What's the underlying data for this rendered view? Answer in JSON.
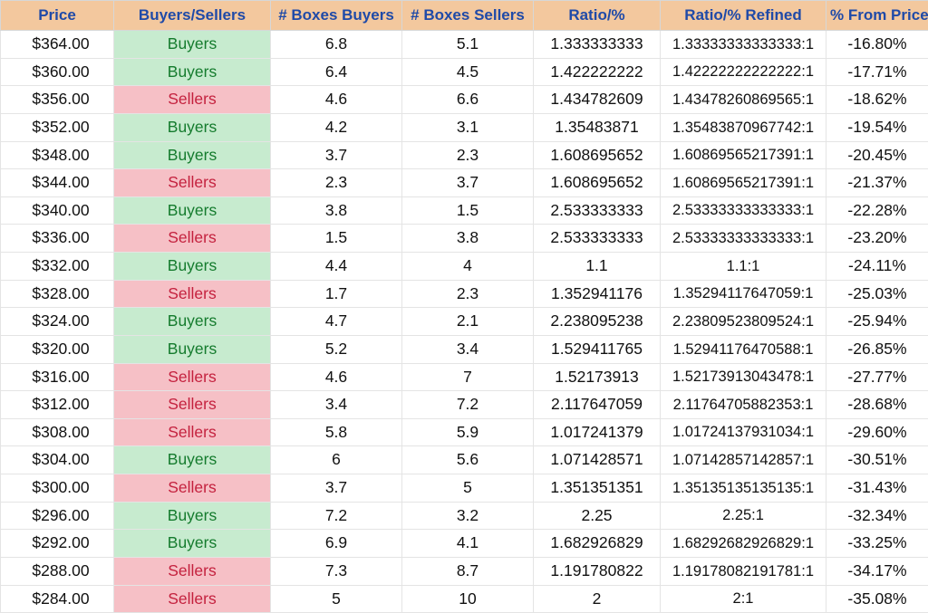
{
  "headers": {
    "price": "Price",
    "bs": "Buyers/Sellers",
    "boxes_buyers": "# Boxes Buyers",
    "boxes_sellers": "# Boxes Sellers",
    "ratio": "Ratio/%",
    "ratio_refined": "Ratio/% Refined",
    "pct_from_price": "% From Price"
  },
  "rows": [
    {
      "price": "$364.00",
      "bs": "Buyers",
      "bs_kind": "buyers",
      "bb": "6.8",
      "bs2": "5.1",
      "ratio": "1.333333333",
      "refined": "1.33333333333333:1",
      "pct": "-16.80%"
    },
    {
      "price": "$360.00",
      "bs": "Buyers",
      "bs_kind": "buyers",
      "bb": "6.4",
      "bs2": "4.5",
      "ratio": "1.422222222",
      "refined": "1.42222222222222:1",
      "pct": "-17.71%"
    },
    {
      "price": "$356.00",
      "bs": "Sellers",
      "bs_kind": "sellers",
      "bb": "4.6",
      "bs2": "6.6",
      "ratio": "1.434782609",
      "refined": "1.43478260869565:1",
      "pct": "-18.62%"
    },
    {
      "price": "$352.00",
      "bs": "Buyers",
      "bs_kind": "buyers",
      "bb": "4.2",
      "bs2": "3.1",
      "ratio": "1.35483871",
      "refined": "1.35483870967742:1",
      "pct": "-19.54%"
    },
    {
      "price": "$348.00",
      "bs": "Buyers",
      "bs_kind": "buyers",
      "bb": "3.7",
      "bs2": "2.3",
      "ratio": "1.608695652",
      "refined": "1.60869565217391:1",
      "pct": "-20.45%"
    },
    {
      "price": "$344.00",
      "bs": "Sellers",
      "bs_kind": "sellers",
      "bb": "2.3",
      "bs2": "3.7",
      "ratio": "1.608695652",
      "refined": "1.60869565217391:1",
      "pct": "-21.37%"
    },
    {
      "price": "$340.00",
      "bs": "Buyers",
      "bs_kind": "buyers",
      "bb": "3.8",
      "bs2": "1.5",
      "ratio": "2.533333333",
      "refined": "2.53333333333333:1",
      "pct": "-22.28%"
    },
    {
      "price": "$336.00",
      "bs": "Sellers",
      "bs_kind": "sellers",
      "bb": "1.5",
      "bs2": "3.8",
      "ratio": "2.533333333",
      "refined": "2.53333333333333:1",
      "pct": "-23.20%"
    },
    {
      "price": "$332.00",
      "bs": "Buyers",
      "bs_kind": "buyers",
      "bb": "4.4",
      "bs2": "4",
      "ratio": "1.1",
      "refined": "1.1:1",
      "pct": "-24.11%"
    },
    {
      "price": "$328.00",
      "bs": "Sellers",
      "bs_kind": "sellers",
      "bb": "1.7",
      "bs2": "2.3",
      "ratio": "1.352941176",
      "refined": "1.35294117647059:1",
      "pct": "-25.03%"
    },
    {
      "price": "$324.00",
      "bs": "Buyers",
      "bs_kind": "buyers",
      "bb": "4.7",
      "bs2": "2.1",
      "ratio": "2.238095238",
      "refined": "2.23809523809524:1",
      "pct": "-25.94%"
    },
    {
      "price": "$320.00",
      "bs": "Buyers",
      "bs_kind": "buyers",
      "bb": "5.2",
      "bs2": "3.4",
      "ratio": "1.529411765",
      "refined": "1.52941176470588:1",
      "pct": "-26.85%"
    },
    {
      "price": "$316.00",
      "bs": "Sellers",
      "bs_kind": "sellers",
      "bb": "4.6",
      "bs2": "7",
      "ratio": "1.52173913",
      "refined": "1.52173913043478:1",
      "pct": "-27.77%"
    },
    {
      "price": "$312.00",
      "bs": "Sellers",
      "bs_kind": "sellers",
      "bb": "3.4",
      "bs2": "7.2",
      "ratio": "2.117647059",
      "refined": "2.11764705882353:1",
      "pct": "-28.68%"
    },
    {
      "price": "$308.00",
      "bs": "Sellers",
      "bs_kind": "sellers",
      "bb": "5.8",
      "bs2": "5.9",
      "ratio": "1.017241379",
      "refined": "1.01724137931034:1",
      "pct": "-29.60%"
    },
    {
      "price": "$304.00",
      "bs": "Buyers",
      "bs_kind": "buyers",
      "bb": "6",
      "bs2": "5.6",
      "ratio": "1.071428571",
      "refined": "1.07142857142857:1",
      "pct": "-30.51%"
    },
    {
      "price": "$300.00",
      "bs": "Sellers",
      "bs_kind": "sellers",
      "bb": "3.7",
      "bs2": "5",
      "ratio": "1.351351351",
      "refined": "1.35135135135135:1",
      "pct": "-31.43%"
    },
    {
      "price": "$296.00",
      "bs": "Buyers",
      "bs_kind": "buyers",
      "bb": "7.2",
      "bs2": "3.2",
      "ratio": "2.25",
      "refined": "2.25:1",
      "pct": "-32.34%"
    },
    {
      "price": "$292.00",
      "bs": "Buyers",
      "bs_kind": "buyers",
      "bb": "6.9",
      "bs2": "4.1",
      "ratio": "1.682926829",
      "refined": "1.68292682926829:1",
      "pct": "-33.25%"
    },
    {
      "price": "$288.00",
      "bs": "Sellers",
      "bs_kind": "sellers",
      "bb": "7.3",
      "bs2": "8.7",
      "ratio": "1.191780822",
      "refined": "1.19178082191781:1",
      "pct": "-34.17%"
    },
    {
      "price": "$284.00",
      "bs": "Sellers",
      "bs_kind": "sellers",
      "bb": "5",
      "bs2": "10",
      "ratio": "2",
      "refined": "2:1",
      "pct": "-35.08%"
    }
  ],
  "chart_data": {
    "type": "table",
    "title": "Price levels with buyer/seller box counts and ratios",
    "columns": [
      "Price",
      "Buyers/Sellers",
      "# Boxes Buyers",
      "# Boxes Sellers",
      "Ratio/%",
      "Ratio/% Refined",
      "% From Price"
    ],
    "rows": [
      [
        364.0,
        "Buyers",
        6.8,
        5.1,
        1.333333333,
        "1.33333333333333:1",
        -16.8
      ],
      [
        360.0,
        "Buyers",
        6.4,
        4.5,
        1.422222222,
        "1.42222222222222:1",
        -17.71
      ],
      [
        356.0,
        "Sellers",
        4.6,
        6.6,
        1.434782609,
        "1.43478260869565:1",
        -18.62
      ],
      [
        352.0,
        "Buyers",
        4.2,
        3.1,
        1.35483871,
        "1.35483870967742:1",
        -19.54
      ],
      [
        348.0,
        "Buyers",
        3.7,
        2.3,
        1.608695652,
        "1.60869565217391:1",
        -20.45
      ],
      [
        344.0,
        "Sellers",
        2.3,
        3.7,
        1.608695652,
        "1.60869565217391:1",
        -21.37
      ],
      [
        340.0,
        "Buyers",
        3.8,
        1.5,
        2.533333333,
        "2.53333333333333:1",
        -22.28
      ],
      [
        336.0,
        "Sellers",
        1.5,
        3.8,
        2.533333333,
        "2.53333333333333:1",
        -23.2
      ],
      [
        332.0,
        "Buyers",
        4.4,
        4.0,
        1.1,
        "1.1:1",
        -24.11
      ],
      [
        328.0,
        "Sellers",
        1.7,
        2.3,
        1.352941176,
        "1.35294117647059:1",
        -25.03
      ],
      [
        324.0,
        "Buyers",
        4.7,
        2.1,
        2.238095238,
        "2.23809523809524:1",
        -25.94
      ],
      [
        320.0,
        "Buyers",
        5.2,
        3.4,
        1.529411765,
        "1.52941176470588:1",
        -26.85
      ],
      [
        316.0,
        "Sellers",
        4.6,
        7.0,
        1.52173913,
        "1.52173913043478:1",
        -27.77
      ],
      [
        312.0,
        "Sellers",
        3.4,
        7.2,
        2.117647059,
        "2.11764705882353:1",
        -28.68
      ],
      [
        308.0,
        "Sellers",
        5.8,
        5.9,
        1.017241379,
        "1.01724137931034:1",
        -29.6
      ],
      [
        304.0,
        "Buyers",
        6.0,
        5.6,
        1.071428571,
        "1.07142857142857:1",
        -30.51
      ],
      [
        300.0,
        "Sellers",
        3.7,
        5.0,
        1.351351351,
        "1.35135135135135:1",
        -31.43
      ],
      [
        296.0,
        "Buyers",
        7.2,
        3.2,
        2.25,
        "2.25:1",
        -32.34
      ],
      [
        292.0,
        "Buyers",
        6.9,
        4.1,
        1.682926829,
        "1.68292682926829:1",
        -33.25
      ],
      [
        288.0,
        "Sellers",
        7.3,
        8.7,
        1.191780822,
        "1.19178082191781:1",
        -34.17
      ],
      [
        284.0,
        "Sellers",
        5.0,
        10.0,
        2.0,
        "2:1",
        -35.08
      ]
    ]
  }
}
